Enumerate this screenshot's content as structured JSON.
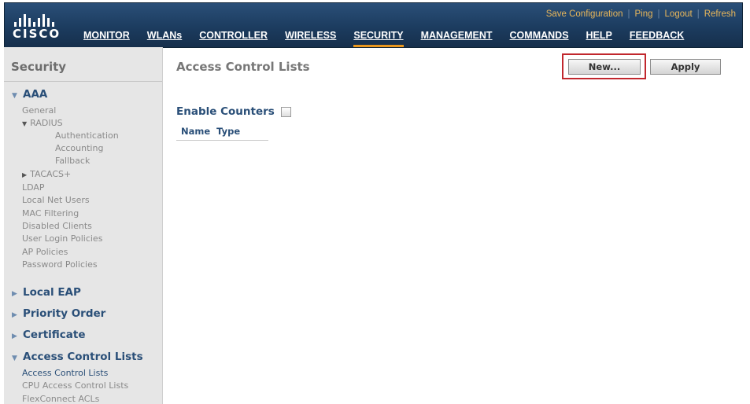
{
  "brand": {
    "logo_text": "CISCO"
  },
  "utility_links": [
    "Save Configuration",
    "Ping",
    "Logout",
    "Refresh"
  ],
  "menu": {
    "items": [
      "MONITOR",
      "WLANs",
      "CONTROLLER",
      "WIRELESS",
      "SECURITY",
      "MANAGEMENT",
      "COMMANDS",
      "HELP",
      "FEEDBACK"
    ],
    "active": "SECURITY"
  },
  "sidebar": {
    "title": "Security",
    "aaa": {
      "label": "AAA",
      "general": "General",
      "radius": "RADIUS",
      "radius_children": [
        "Authentication",
        "Accounting",
        "Fallback"
      ],
      "tacacs": "TACACS+",
      "items": [
        "LDAP",
        "Local Net Users",
        "MAC Filtering",
        "Disabled Clients",
        "User Login Policies",
        "AP Policies",
        "Password Policies"
      ]
    },
    "sections": [
      "Local EAP",
      "Priority Order",
      "Certificate"
    ],
    "acl": {
      "label": "Access Control Lists",
      "children": [
        "Access Control Lists",
        "CPU Access Control Lists",
        "FlexConnect ACLs"
      ]
    }
  },
  "main": {
    "title": "Access Control Lists",
    "new_button": "New...",
    "apply_button": "Apply",
    "enable_counters_label": "Enable Counters",
    "enable_counters_checked": false,
    "columns": [
      "Name",
      "Type"
    ]
  },
  "figure_id": "353129",
  "colors": {
    "header_bg": "#1c3c5f",
    "active_underline": "#e8961e",
    "link_blue": "#2a4f78",
    "highlight_frame": "#c1272d"
  }
}
